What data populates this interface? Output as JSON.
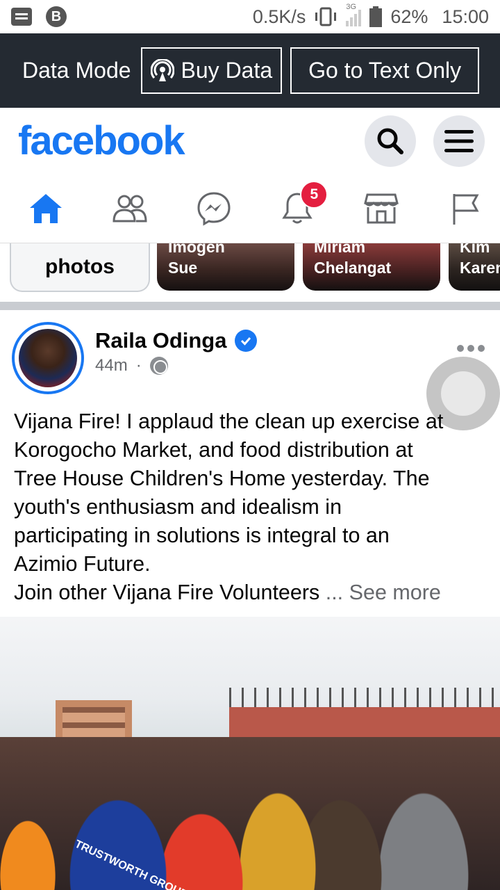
{
  "status_bar": {
    "network_speed": "0.5K/s",
    "network_type": "3G",
    "battery": "62%",
    "time": "15:00",
    "left_icons": [
      "message-icon",
      "b-icon"
    ]
  },
  "data_bar": {
    "label": "Data Mode",
    "buy_data": "Buy Data",
    "text_only": "Go to Text Only"
  },
  "header": {
    "logo": "facebook",
    "brand_color": "#1877f2"
  },
  "nav": {
    "tabs": [
      "home-icon",
      "friends-icon",
      "messenger-icon",
      "notifications-icon",
      "marketplace-icon",
      "pages-icon"
    ],
    "notification_count": "5",
    "active_color": "#1877f2"
  },
  "stories": {
    "photos_label": "photos",
    "cards": [
      {
        "line1": "Imogen",
        "line2": "Sue"
      },
      {
        "line1": "Miriam",
        "line2": "Chelangat"
      },
      {
        "line1": "Kim",
        "line2": "Karen"
      }
    ]
  },
  "post": {
    "author": "Raila Odinga",
    "time": "44m",
    "separator": "·",
    "lines": [
      "Vijana Fire! I applaud the clean up exercise at",
      "Korogocho Market, and food distribution at",
      "Tree House Children's Home yesterday. The",
      "youth's enthusiasm and idealism in",
      "participating in solutions is integral to an",
      "Azimio Future.",
      "Join other Vijana Fire Volunteers"
    ],
    "ellipsis": " ...",
    "see_more": " See more",
    "image_text": "TRUSTWORTH GROUP"
  }
}
